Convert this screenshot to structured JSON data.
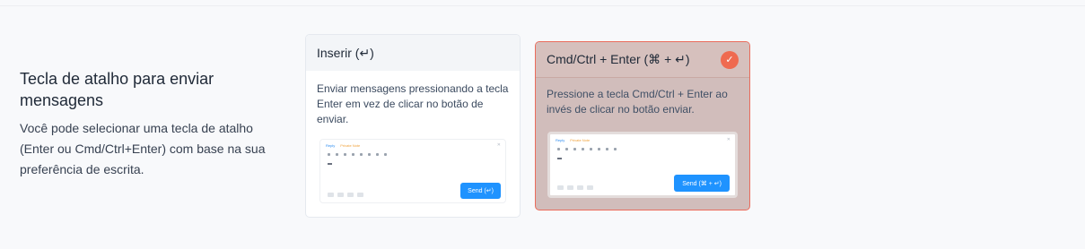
{
  "setting": {
    "title": "Tecla de atalho para enviar mensagens",
    "description": "Você pode selecionar uma tecla de atalho (Enter ou Cmd/Ctrl+Enter) com base na sua preferência de escrita."
  },
  "options": [
    {
      "title": "Inserir (↵)",
      "description": "Enviar mensagens pressionando a tecla Enter em vez de clicar no botão de enviar.",
      "selected": false,
      "preview": {
        "tab_reply": "Reply",
        "tab_note": "Private Note",
        "send_label": "Send (↵)"
      }
    },
    {
      "title": "Cmd/Ctrl + Enter (⌘ + ↵)",
      "description": "Pressione a tecla Cmd/Ctrl + Enter ao invés de clicar no botão enviar.",
      "selected": true,
      "preview": {
        "tab_reply": "Reply",
        "tab_note": "Private Note",
        "send_label": "Send (⌘ + ↵)"
      }
    }
  ],
  "colors": {
    "accent": "#1f93ff",
    "selected_border": "#ea6c5c",
    "check": "#ef6a50"
  },
  "icons": {
    "selected": "check-icon",
    "close": "close-icon"
  }
}
